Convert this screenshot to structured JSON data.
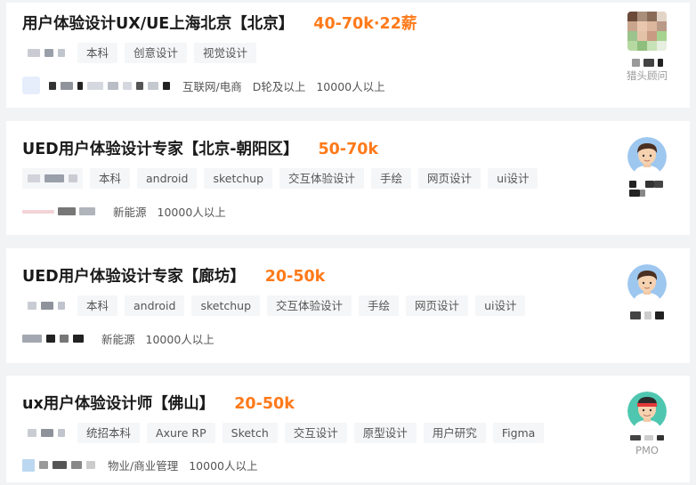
{
  "jobs": [
    {
      "title": "用户体验设计UX/UE上海北京【北京】",
      "salary": "40-70k·22薪",
      "tags": [
        "本科",
        "创意设计",
        "视觉设计"
      ],
      "company_info": [
        "互联网/电商",
        "D轮及以上",
        "10000人以上"
      ],
      "recruiter_label": "猎头顾问",
      "avatar_style": "pixelated"
    },
    {
      "title": "UED用户体验设计专家【北京-朝阳区】",
      "salary": "50-70k",
      "tags": [
        "本科",
        "android",
        "sketchup",
        "交互体验设计",
        "手绘",
        "网页设计",
        "ui设计"
      ],
      "company_info": [
        "新能源",
        "10000人以上"
      ],
      "recruiter_label": "",
      "avatar_style": "cartoon-man"
    },
    {
      "title": "UED用户体验设计专家【廊坊】",
      "salary": "20-50k",
      "tags": [
        "本科",
        "android",
        "sketchup",
        "交互体验设计",
        "手绘",
        "网页设计",
        "ui设计"
      ],
      "company_info": [
        "新能源",
        "10000人以上"
      ],
      "recruiter_label": "",
      "avatar_style": "cartoon-man"
    },
    {
      "title": "ux用户体验设计师【佛山】",
      "salary": "20-50k",
      "tags": [
        "统招本科",
        "Axure RP",
        "Sketch",
        "交互设计",
        "原型设计",
        "用户研究",
        "Figma"
      ],
      "company_info": [
        "物业/商业管理",
        "10000人以上"
      ],
      "recruiter_label": "PMO",
      "avatar_style": "cartoon-headband"
    }
  ],
  "colors": {
    "salary": "#ff7a1a",
    "title": "#1a1a1a",
    "tag_bg": "#f5f6f8",
    "page_bg": "#f2f3f5"
  }
}
